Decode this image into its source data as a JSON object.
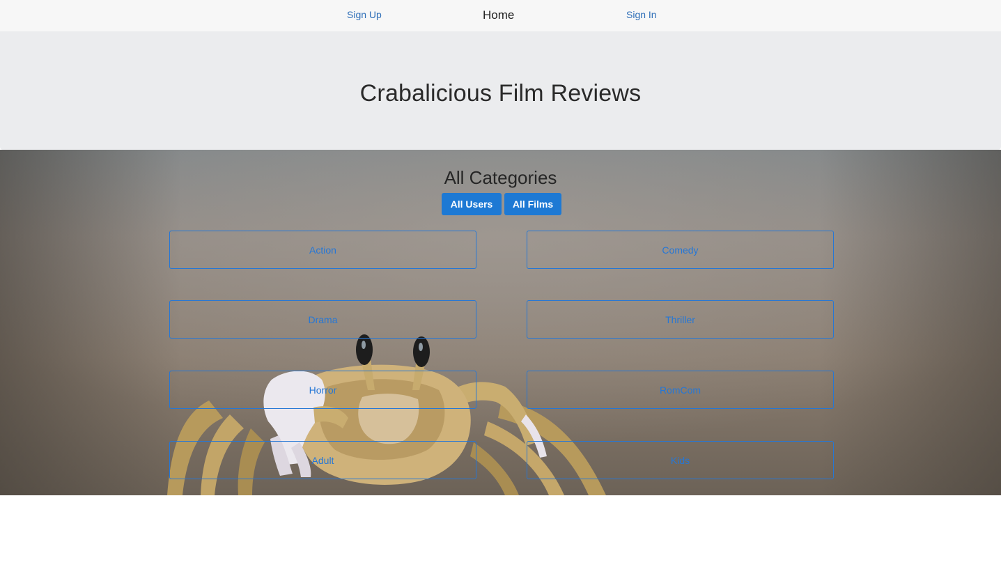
{
  "nav": {
    "signup_label": "Sign Up",
    "home_label": "Home",
    "signin_label": "Sign In"
  },
  "header": {
    "title": "Crabalicious Film Reviews"
  },
  "categories": {
    "heading": "All Categories",
    "all_users_label": "All Users",
    "all_films_label": "All Films",
    "items": [
      {
        "label": "Action"
      },
      {
        "label": "Comedy"
      },
      {
        "label": "Drama"
      },
      {
        "label": "Thriller"
      },
      {
        "label": "Horror"
      },
      {
        "label": "RomCom"
      },
      {
        "label": "Adult"
      },
      {
        "label": "Kids"
      }
    ]
  },
  "colors": {
    "accent": "#1d79d4",
    "outline": "#2577d6",
    "navbar_bg": "#f7f7f7",
    "jumbotron_bg": "#ebecee"
  }
}
